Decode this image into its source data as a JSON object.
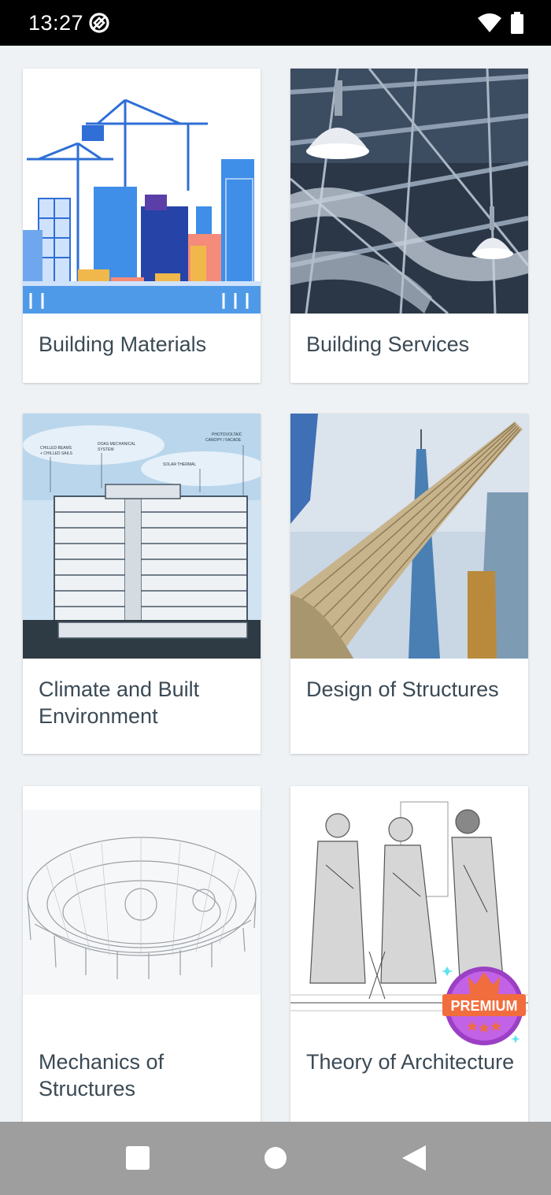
{
  "status_bar": {
    "time": "13:27",
    "app_icon": "circle-slash-icon",
    "wifi_icon": "wifi-icon",
    "battery_icon": "battery-icon"
  },
  "cards": [
    {
      "title": "Building Materials",
      "image": "construction-skyline-illustration"
    },
    {
      "title": "Building Services",
      "image": "ceiling-ducts-and-lamps-photo"
    },
    {
      "title": "Climate and Built Environment",
      "image": "building-section-diagram"
    },
    {
      "title": "Design of Structures",
      "image": "oculus-and-tower-photo"
    },
    {
      "title": "Mechanics of Structures",
      "image": "stadium-wireframe-sketch"
    },
    {
      "title": "Theory of Architecture",
      "image": "medieval-builders-engraving"
    }
  ],
  "premium_badge": {
    "label": "PREMIUM"
  },
  "nav_bar": {
    "recents_icon": "square-icon",
    "home_icon": "circle-icon",
    "back_icon": "triangle-back-icon"
  },
  "colors": {
    "background": "#eff2f5",
    "card": "#ffffff",
    "title_text": "#3b4a55",
    "status_bar": "#000000",
    "nav_bar": "#9e9e9e",
    "premium_orange": "#f26d3d",
    "premium_purple": "#9b3fc4"
  }
}
